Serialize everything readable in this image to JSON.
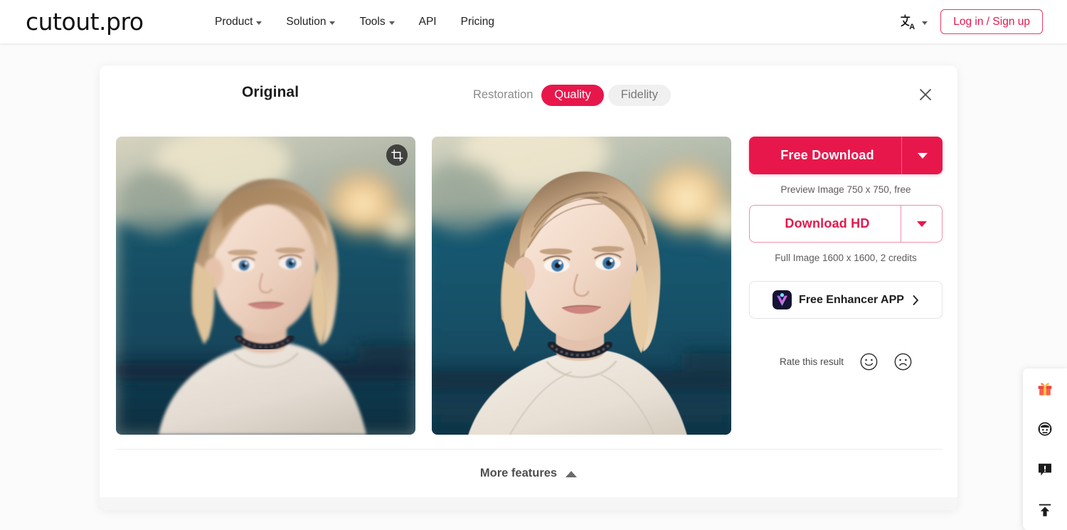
{
  "header": {
    "logo": "cutout.pro",
    "nav": [
      {
        "label": "Product",
        "has_caret": true
      },
      {
        "label": "Solution",
        "has_caret": true
      },
      {
        "label": "Tools",
        "has_caret": true
      },
      {
        "label": "API",
        "has_caret": false
      },
      {
        "label": "Pricing",
        "has_caret": false
      }
    ],
    "language_icon": "translate-icon",
    "login_label": "Log in / Sign up"
  },
  "card": {
    "original_title": "Original",
    "modes": {
      "group_label": "Restoration",
      "options": [
        {
          "label": "Quality",
          "active": true
        },
        {
          "label": "Fidelity",
          "active": false
        }
      ]
    },
    "close_icon": "close-icon",
    "crop_icon": "crop-icon"
  },
  "actions": {
    "free_download": {
      "label": "Free Download",
      "caption": "Preview Image 750 x 750, free",
      "dropdown_icon": "caret-down-icon"
    },
    "download_hd": {
      "label": "Download HD",
      "caption": "Full Image 1600 x 1600, 2 credits",
      "dropdown_icon": "caret-down-icon"
    },
    "enhancer_app": {
      "label": "Free Enhancer APP",
      "chevron_icon": "chevron-right-icon",
      "app_icon": "enhancer-app-icon"
    },
    "rating": {
      "label": "Rate this result",
      "happy_icon": "smiley-happy-icon",
      "sad_icon": "smiley-sad-icon"
    }
  },
  "more_features": {
    "label": "More features",
    "icon": "triangle-up-icon"
  },
  "side_toolbar": [
    {
      "name": "gift-icon",
      "title": "gift"
    },
    {
      "name": "support-agent-icon",
      "title": "customer service"
    },
    {
      "name": "feedback-icon",
      "title": "feedback"
    },
    {
      "name": "back-to-top-icon",
      "title": "back to top"
    }
  ],
  "colors": {
    "brand_pink": "#e8174b",
    "brand_pink_light": "#ef90a8",
    "page_bg": "#fbfbfb",
    "card_bg": "#ffffff",
    "pill_inactive_bg": "#f0f0f0",
    "text_dark": "#1c1c1c",
    "text_muted": "#8b8b8b"
  }
}
